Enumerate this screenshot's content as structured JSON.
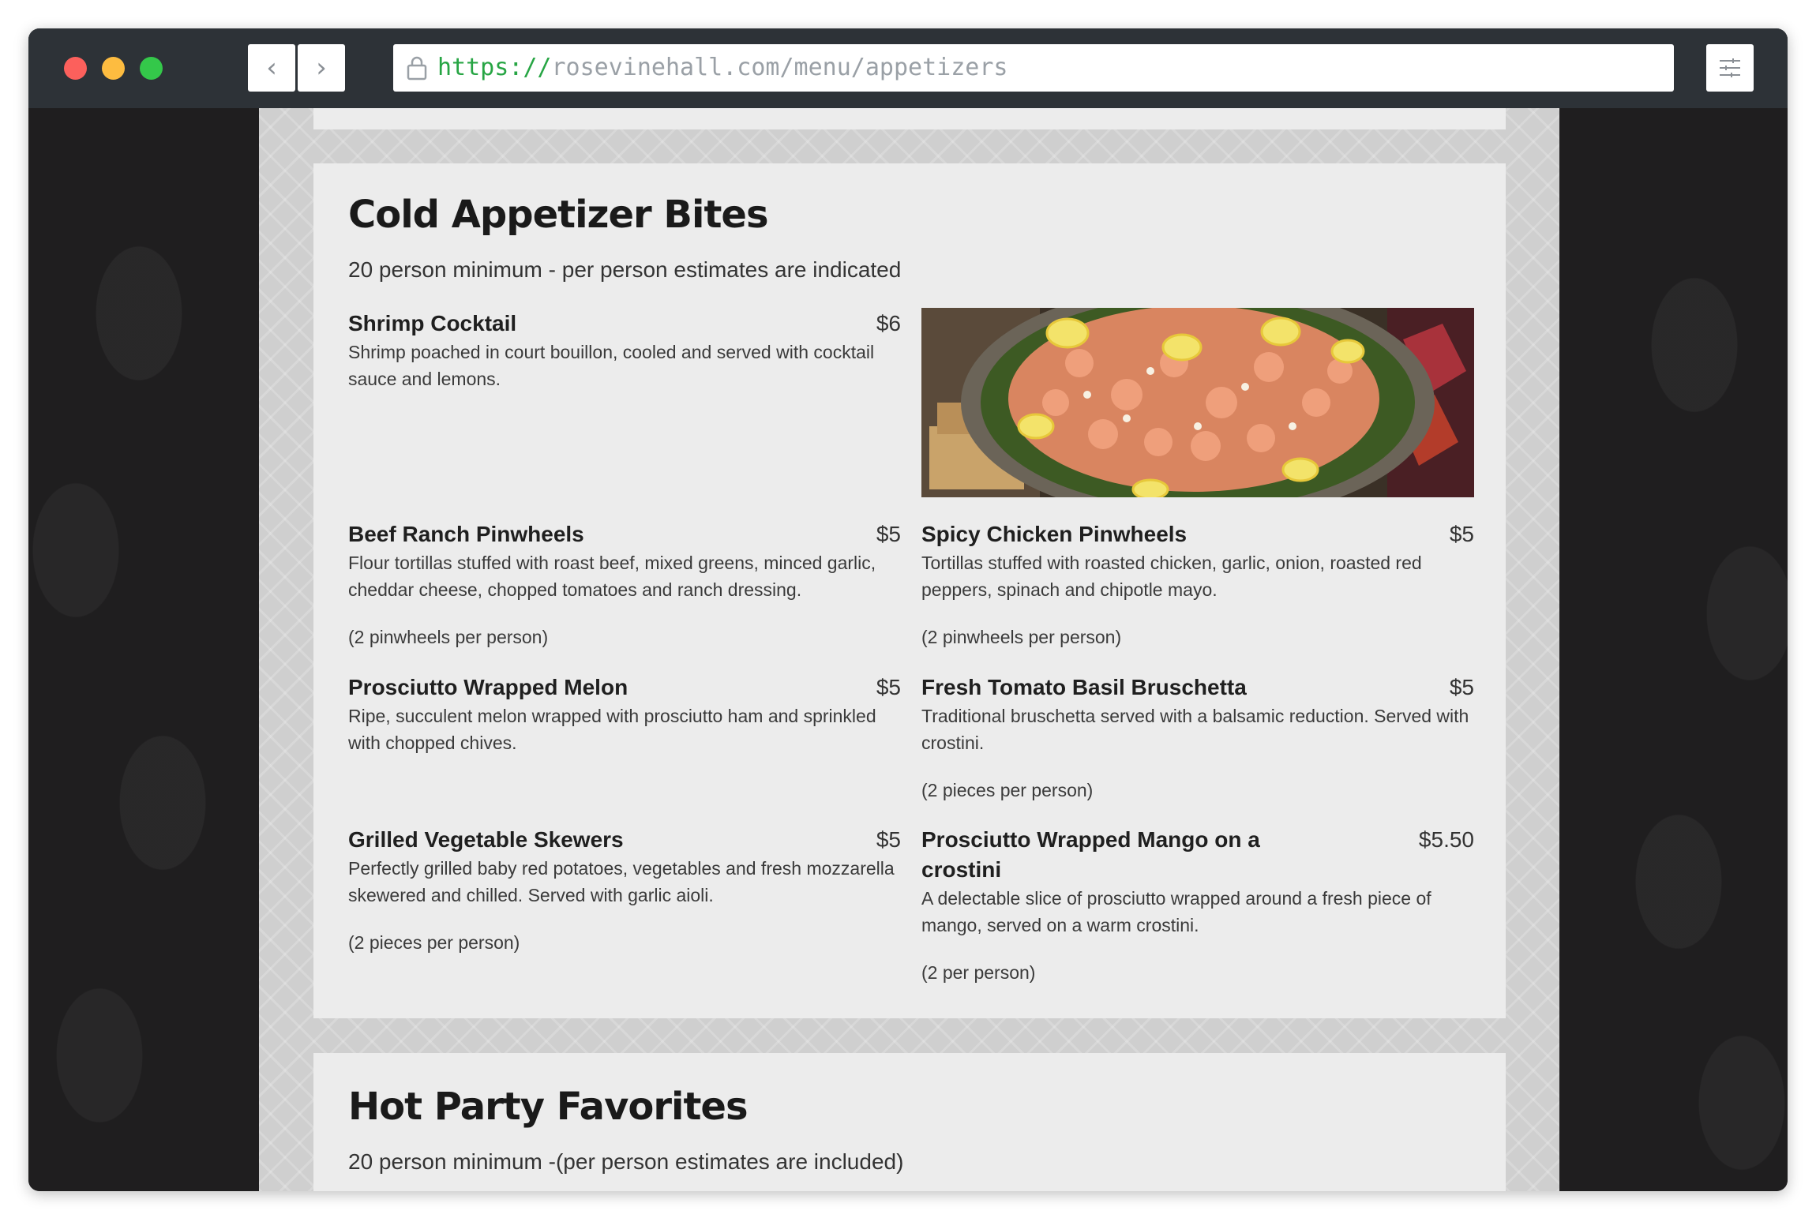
{
  "browser": {
    "url_scheme": "https://",
    "url_rest": "rosevinehall.com/menu/appetizers"
  },
  "cold_section": {
    "title": "Cold Appetizer Bites",
    "subtitle": "20 person minimum - per person estimates are indicated",
    "items": [
      {
        "name": "Shrimp Cocktail",
        "price": "$6",
        "desc": "Shrimp poached in court bouillon, cooled and served with cocktail sauce and lemons.",
        "note": ""
      },
      {
        "name": "Beef Ranch Pinwheels",
        "price": "$5",
        "desc": "Flour tortillas stuffed with roast beef, mixed greens, minced garlic, cheddar cheese, chopped tomatoes and ranch dressing.",
        "note": "(2 pinwheels per person)"
      },
      {
        "name": "Spicy Chicken Pinwheels",
        "price": "$5",
        "desc": "Tortillas stuffed with roasted chicken, garlic, onion, roasted red peppers, spinach and chipotle mayo.",
        "note": "(2 pinwheels per person)"
      },
      {
        "name": "Prosciutto Wrapped Melon",
        "price": "$5",
        "desc": "Ripe, succulent melon wrapped with prosciutto ham and sprinkled with chopped chives.",
        "note": ""
      },
      {
        "name": "Fresh Tomato Basil Bruschetta",
        "price": "$5",
        "desc": "Traditional bruschetta served with a balsamic reduction. Served with crostini.",
        "note": "(2 pieces per person)"
      },
      {
        "name": "Grilled Vegetable Skewers",
        "price": "$5",
        "desc": "Perfectly grilled baby red potatoes, vegetables and fresh mozzarella skewered and chilled. Served with garlic aioli.",
        "note": "(2 pieces per person)"
      },
      {
        "name": "Prosciutto Wrapped Mango on a crostini",
        "price": "$5.50",
        "desc": "A delectable slice of prosciutto wrapped around a fresh piece of mango, served on a warm crostini.",
        "note": "(2 per person)"
      }
    ]
  },
  "hot_section": {
    "title": "Hot Party Favorites",
    "subtitle": "20 person minimum -(per person estimates are included)"
  }
}
